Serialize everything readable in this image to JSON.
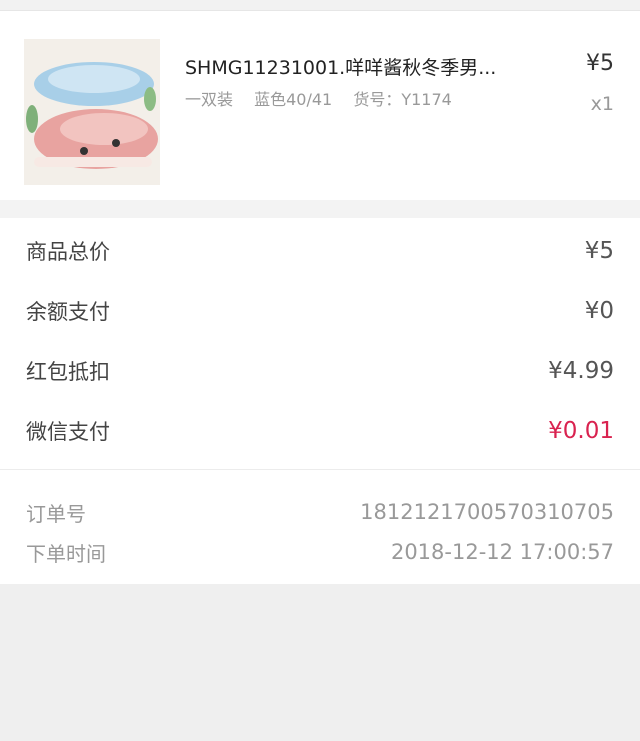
{
  "product": {
    "title": "SHMG11231001.咩咩酱秋冬季男...",
    "spec_pack": "一双装",
    "spec_variant": "蓝色40/41",
    "spec_code": "货号：Y1174",
    "price": "¥5",
    "quantity": "x1"
  },
  "summary": {
    "items": [
      {
        "label": "商品总价",
        "value": "¥5"
      },
      {
        "label": "余额支付",
        "value": "¥0"
      },
      {
        "label": "红包抵扣",
        "value": "¥4.99"
      },
      {
        "label": "微信支付",
        "value": "¥0.01"
      }
    ],
    "highlight_color": "#d9224f"
  },
  "order": {
    "number_label": "订单号",
    "number_value": "1812121700570310705",
    "time_label": "下单时间",
    "time_value": "2018-12-12 17:00:57"
  }
}
